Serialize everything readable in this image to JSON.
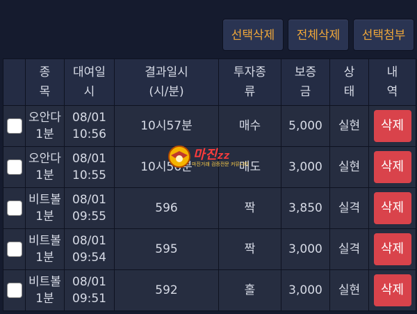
{
  "toolbar": {
    "select_delete": "선택삭제",
    "all_delete": "전체삭제",
    "select_attach": "선택첨부"
  },
  "table": {
    "headers": {
      "type": [
        "종",
        "목"
      ],
      "rent_date": [
        "대여일",
        "시"
      ],
      "result_time": [
        "결과일시",
        "(시/분)"
      ],
      "invest_type": [
        "투자종",
        "류"
      ],
      "deposit": [
        "보증",
        "금"
      ],
      "status": [
        "상",
        "태"
      ],
      "detail": [
        "내",
        "역"
      ]
    },
    "rows": [
      {
        "type": [
          "오안다",
          "1분"
        ],
        "date": [
          "08/01",
          "10:56"
        ],
        "result": "10시57분",
        "invest": "매수",
        "deposit": "5,000",
        "status": "실현",
        "status_kind": "win",
        "action": "삭제"
      },
      {
        "type": [
          "오안다",
          "1분"
        ],
        "date": [
          "08/01",
          "10:55"
        ],
        "result": "10시56분",
        "invest": "매도",
        "deposit": "3,000",
        "status": "실현",
        "status_kind": "win",
        "action": "삭제"
      },
      {
        "type": [
          "비트볼",
          "1분"
        ],
        "date": [
          "08/01",
          "09:55"
        ],
        "result": "596",
        "invest": "짝",
        "deposit": "3,850",
        "status": "실격",
        "status_kind": "lose",
        "action": "삭제"
      },
      {
        "type": [
          "비트볼",
          "1분"
        ],
        "date": [
          "08/01",
          "09:54"
        ],
        "result": "595",
        "invest": "짝",
        "deposit": "3,000",
        "status": "실격",
        "status_kind": "lose",
        "action": "삭제"
      },
      {
        "type": [
          "비트볼",
          "1분"
        ],
        "date": [
          "08/01",
          "09:51"
        ],
        "result": "592",
        "invest": "홀",
        "deposit": "3,000",
        "status": "실현",
        "status_kind": "win",
        "action": "삭제"
      }
    ]
  },
  "watermark": {
    "brand": "마진",
    "brand_suffix": "ZZ",
    "tagline": "마진거래 검증전문 커뮤니티"
  },
  "colors": {
    "accent_button_text": "#f0a83a",
    "status_win": "#4caf50",
    "status_lose": "#e53935",
    "delete_button": "#d9434b"
  }
}
